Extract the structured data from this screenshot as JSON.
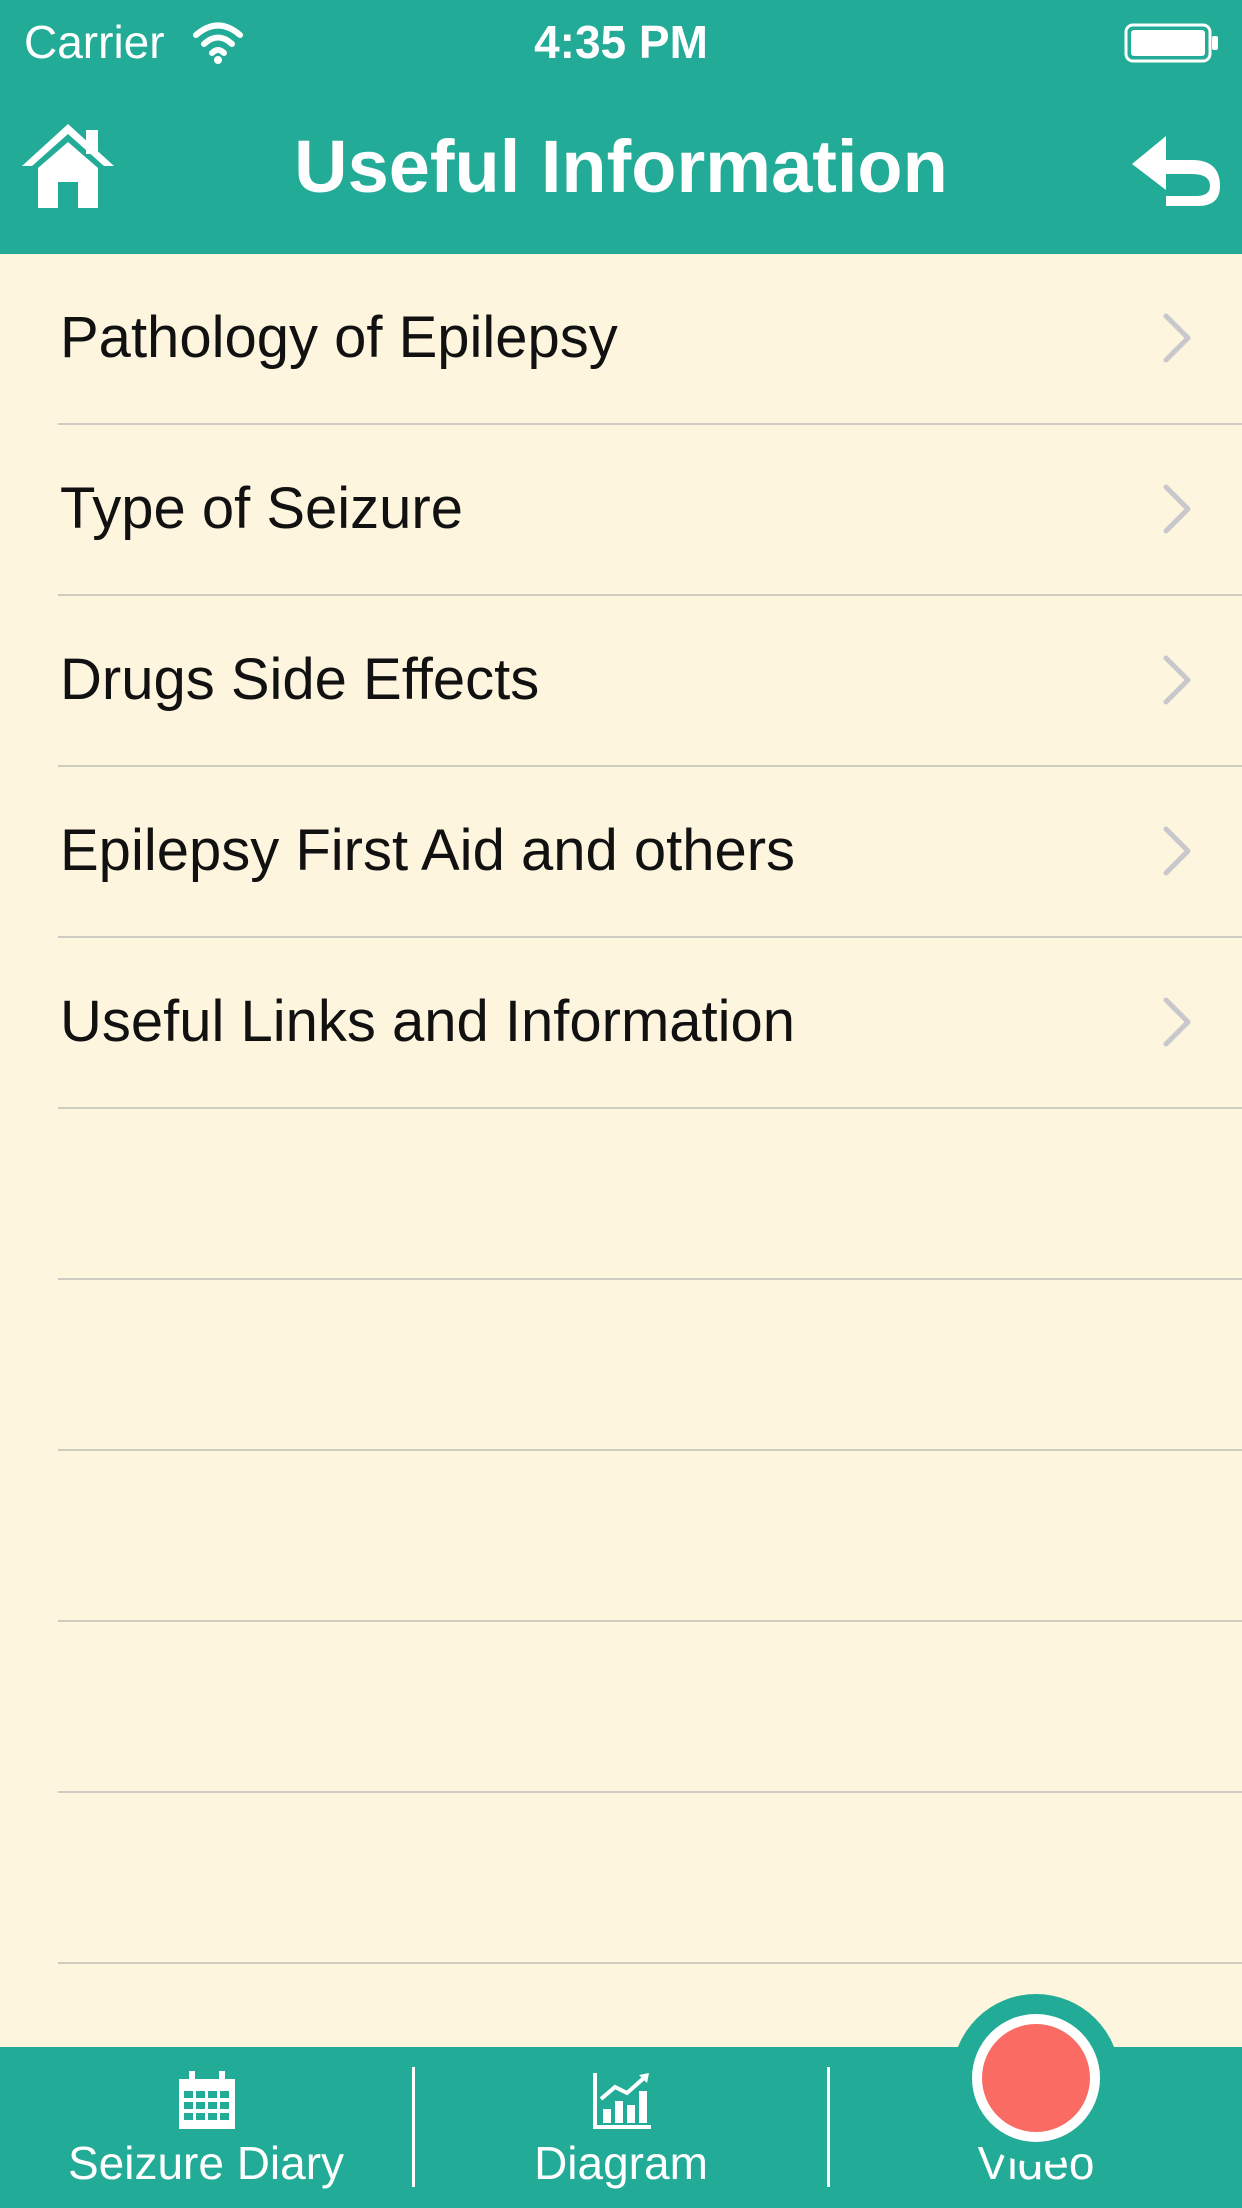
{
  "status_bar": {
    "carrier": "Carrier",
    "time": "4:35 PM",
    "wifi_icon": "wifi-icon",
    "battery_icon": "battery-icon"
  },
  "nav": {
    "title": "Useful Information",
    "left_icon": "home-icon",
    "right_icon": "back-arrow-icon"
  },
  "colors": {
    "accent": "#22AB96",
    "background": "#FDF5DE",
    "record": "#FA6B63",
    "separator": "#CFCCC2",
    "chevron": "#C7C7CC"
  },
  "menu": {
    "items": [
      {
        "label": "Pathology of Epilepsy"
      },
      {
        "label": "Type of Seizure"
      },
      {
        "label": "Drugs Side Effects"
      },
      {
        "label": "Epilepsy First Aid and others"
      },
      {
        "label": "Useful Links and Information"
      }
    ],
    "empty_rows": 5
  },
  "tabbar": {
    "tabs": [
      {
        "label": "Seizure Diary",
        "icon": "calendar-icon"
      },
      {
        "label": "Diagram",
        "icon": "chart-icon"
      },
      {
        "label": "Video",
        "icon": "record-icon"
      }
    ]
  }
}
